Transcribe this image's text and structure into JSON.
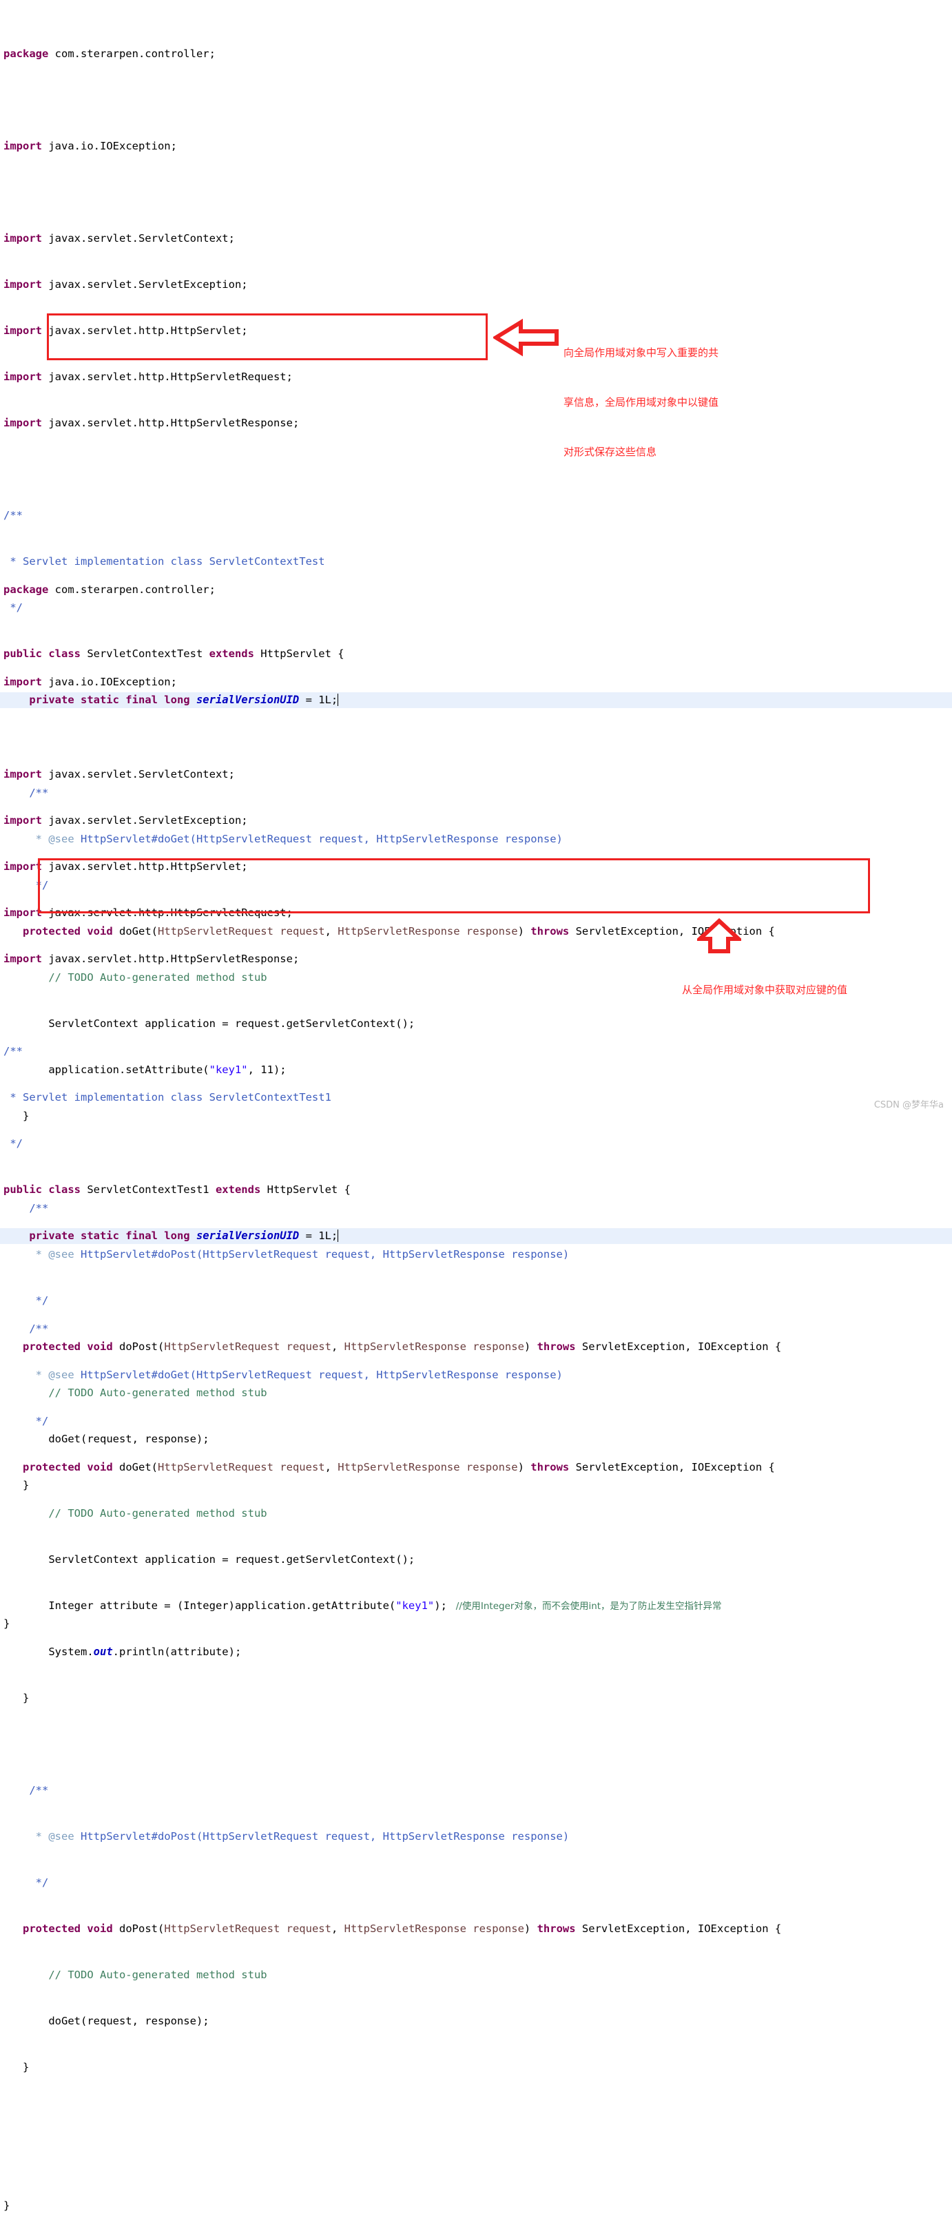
{
  "editor": {
    "language": "java",
    "highlight_color": "#e8f0fc",
    "keyword_color": "#7f0055",
    "string_color": "#2a00ff",
    "comment_color": "#3f7f5f",
    "javadoc_color": "#3f5fbf",
    "annotation_color": "#ff2a2a",
    "box_color": "#ee2222"
  },
  "snippet1": {
    "package": {
      "kw": "package",
      "rest": " com.sterarpen.controller;"
    },
    "imports": [
      {
        "kw": "import",
        "rest": " java.io.IOException;"
      },
      {
        "kw": "import",
        "rest": " javax.servlet.ServletContext;"
      },
      {
        "kw": "import",
        "rest": " javax.servlet.ServletException;"
      },
      {
        "kw": "import",
        "rest": " javax.servlet.http.HttpServlet;"
      },
      {
        "kw": "import",
        "rest": " javax.servlet.http.HttpServletRequest;"
      },
      {
        "kw": "import",
        "rest": " javax.servlet.http.HttpServletResponse;"
      }
    ],
    "classdoc": {
      "open": "/**",
      "body": " * Servlet implementation class ServletContextTest",
      "close": " */"
    },
    "classdecl": {
      "mod": "public class",
      "name": " ServletContextTest ",
      "ext": "extends",
      "tail": " HttpServlet {"
    },
    "serial": {
      "mods": "private static final long",
      "field": " serialVersionUID",
      "value": " = 1L;"
    },
    "doget_doc": {
      "open": "/**",
      "tag": " * @see",
      "body": " HttpServlet#doGet(HttpServletRequest request, HttpServletResponse response)",
      "close": " */"
    },
    "doget_sig": {
      "mod": "protected void",
      "name": " doGet(",
      "p1": "HttpServletRequest request",
      "sep": ", ",
      "p2": "HttpServletResponse response",
      "close": ") ",
      "throws": "throws",
      "tail": " ServletException, IOException {"
    },
    "doget_body": [
      "// TODO Auto-generated method stub",
      "ServletContext application = request.getServletContext();",
      "application.setAttribute(\"key1\", 11);",
      "}"
    ],
    "dopost_doc": {
      "open": "/**",
      "tag": " * @see",
      "body": " HttpServlet#doPost(HttpServletRequest request, HttpServletResponse response)",
      "close": " */"
    },
    "dopost_sig": {
      "mod": "protected void",
      "name": " doPost(",
      "p1": "HttpServletRequest request",
      "sep": ", ",
      "p2": "HttpServletResponse response",
      "close": ") ",
      "throws": "throws",
      "tail": " ServletException, IOException {"
    },
    "dopost_body": [
      "// TODO Auto-generated method stub",
      "doGet(request, response);",
      "}"
    ],
    "class_close": "}"
  },
  "snippet2": {
    "package": {
      "kw": "package",
      "rest": " com.sterarpen.controller;"
    },
    "imports": [
      {
        "kw": "import",
        "rest": " java.io.IOException;"
      },
      {
        "kw": "import",
        "rest": " javax.servlet.ServletContext;"
      },
      {
        "kw": "import",
        "rest": " javax.servlet.ServletException;"
      },
      {
        "kw": "import",
        "rest": " javax.servlet.http.HttpServlet;"
      },
      {
        "kw": "import",
        "rest": " javax.servlet.http.HttpServletRequest;"
      },
      {
        "kw": "import",
        "rest": " javax.servlet.http.HttpServletResponse;"
      }
    ],
    "classdoc": {
      "open": "/**",
      "body": " * Servlet implementation class ServletContextTest1",
      "close": " */"
    },
    "classdecl": {
      "mod": "public class",
      "name": " ServletContextTest1 ",
      "ext": "extends",
      "tail": " HttpServlet {"
    },
    "serial": {
      "mods": "private static final long",
      "field": " serialVersionUID",
      "value": " = 1L;"
    },
    "doget_doc": {
      "open": "/**",
      "tag": " * @see",
      "body": " HttpServlet#doGet(HttpServletRequest request, HttpServletResponse response)",
      "close": " */"
    },
    "doget_sig": {
      "mod": "protected void",
      "name": " doGet(",
      "p1": "HttpServletRequest request",
      "sep": ", ",
      "p2": "HttpServletResponse response",
      "close": ") ",
      "throws": "throws",
      "tail": " ServletException, IOException {"
    },
    "doget_body": {
      "todo": "// TODO Auto-generated method stub",
      "l1": "ServletContext application = request.getServletContext();",
      "l2a": "Integer attribute = (Integer)application.getAttribute(",
      "l2str": "\"key1\"",
      "l2b": ");",
      "l2comment": "//使用Integer对象，而不会使用int，是为了防止发生空指针异常",
      "l3a": "System.",
      "l3out": "out",
      "l3b": ".println(attribute);",
      "close": "}"
    },
    "dopost_doc": {
      "open": "/**",
      "tag": " * @see",
      "body": " HttpServlet#doPost(HttpServletRequest request, HttpServletResponse response)",
      "close": " */"
    },
    "dopost_sig": {
      "mod": "protected void",
      "name": " doPost(",
      "p1": "HttpServletRequest request",
      "sep": ", ",
      "p2": "HttpServletResponse response",
      "close": ") ",
      "throws": "throws",
      "tail": " ServletException, IOException {"
    },
    "dopost_body": [
      "// TODO Auto-generated method stub",
      "doGet(request, response);",
      "}"
    ],
    "class_close": "}"
  },
  "annotations": {
    "top": {
      "line1": "向全局作用域对象中写入重要的共",
      "line2": "享信息，全局作用域对象中以键值",
      "line3": "对形式保存这些信息"
    },
    "bottom": {
      "line1": "从全局作用域对象中获取对应键的值"
    }
  },
  "watermark": "CSDN @梦年华a"
}
